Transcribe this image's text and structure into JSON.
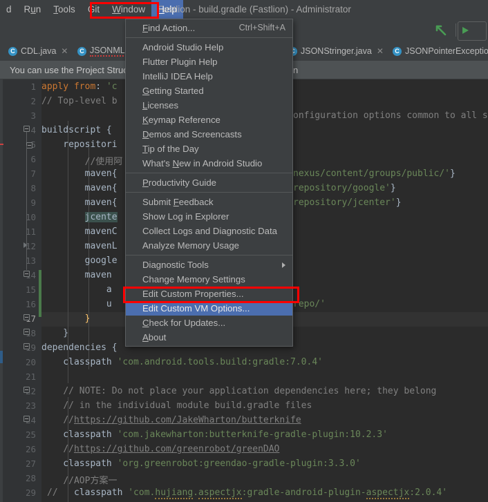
{
  "window": {
    "title": "Fastlion - build.gradle (Fastlion) - Administrator"
  },
  "menubar": {
    "items": [
      {
        "label": "d",
        "accel": ""
      },
      {
        "label": "Run",
        "accel": "u"
      },
      {
        "label": "Tools",
        "accel": "T"
      },
      {
        "label": "Git",
        "accel": ""
      },
      {
        "label": "Window",
        "accel": "W"
      },
      {
        "label": "Help",
        "accel": "H",
        "active": true
      }
    ]
  },
  "toolbar": {
    "back_icon": "back-arrow-icon",
    "run_icon": "run-button-icon"
  },
  "tabs": [
    {
      "label": "CDL.java",
      "icon": "C",
      "closable": true,
      "error": false
    },
    {
      "label": "JSONML.java",
      "icon": "C",
      "closable": true,
      "error": true
    },
    {
      "label": "JSONStringer.java",
      "icon": "C",
      "closable": true,
      "error": false
    },
    {
      "label": "JSONPointerException.java",
      "icon": "C",
      "closable": false,
      "error": false
    }
  ],
  "banner": {
    "text": "You can use the Project Structure dialog to manage project configuration"
  },
  "help_menu": {
    "items": [
      {
        "label": "Find Action...",
        "accel": "F",
        "shortcut": "Ctrl+Shift+A"
      },
      {
        "separator": true
      },
      {
        "label": "Android Studio Help",
        "accel": ""
      },
      {
        "label": "Flutter Plugin Help",
        "accel": ""
      },
      {
        "label": "IntelliJ IDEA Help",
        "accel": ""
      },
      {
        "label": "Getting Started",
        "accel": "G"
      },
      {
        "label": "Licenses",
        "accel": "L"
      },
      {
        "label": "Keymap Reference",
        "accel": "K"
      },
      {
        "label": "Demos and Screencasts",
        "accel": "D"
      },
      {
        "label": "Tip of the Day",
        "accel": "T"
      },
      {
        "label": "What's New in Android Studio",
        "accel": "N"
      },
      {
        "separator": true
      },
      {
        "label": "Productivity Guide",
        "accel": "P"
      },
      {
        "separator": true
      },
      {
        "label": "Submit Feedback",
        "accel": "F"
      },
      {
        "label": "Show Log in Explorer",
        "accel": ""
      },
      {
        "label": "Collect Logs and Diagnostic Data",
        "accel": ""
      },
      {
        "label": "Analyze Memory Usage",
        "accel": ""
      },
      {
        "separator": true
      },
      {
        "label": "Diagnostic Tools",
        "accel": "",
        "submenu": true
      },
      {
        "label": "Change Memory Settings",
        "accel": ""
      },
      {
        "label": "Edit Custom Properties...",
        "accel": ""
      },
      {
        "label": "Edit Custom VM Options...",
        "accel": "",
        "selected": true
      },
      {
        "label": "Check for Updates...",
        "accel": "C"
      },
      {
        "label": "About",
        "accel": "A"
      }
    ]
  },
  "annotations": {
    "help_box_color": "#ff0000",
    "vm_options_box_color": "#ff0000",
    "selection_color": "#4b6eaf"
  },
  "editor": {
    "current_line": 17,
    "lines": [
      {
        "n": 1,
        "html": "<span class=\"kw\">apply</span> <span class=\"kw\">from</span>: <span class=\"str\">'c</span>"
      },
      {
        "n": 2,
        "html": "<span class=\"cmt\">// Top-level b</span>"
      },
      {
        "n": 3,
        "html": ""
      },
      {
        "n": 4,
        "html": "buildscript {"
      },
      {
        "n": 5,
        "html": "    repositori"
      },
      {
        "n": 6,
        "html": "        <span class=\"cmt\">//使用阿</span>"
      },
      {
        "n": 7,
        "html": "        maven{"
      },
      {
        "n": 8,
        "html": "        maven{"
      },
      {
        "n": 9,
        "html": "        maven{"
      },
      {
        "n": 10,
        "html": "        <span class=\"hl\">jcente</span>"
      },
      {
        "n": 11,
        "html": "        mavenC"
      },
      {
        "n": 12,
        "html": "        mavenL"
      },
      {
        "n": 13,
        "html": "        google"
      },
      {
        "n": 14,
        "html": "        maven "
      },
      {
        "n": 15,
        "html": "            a"
      },
      {
        "n": 16,
        "html": "            u"
      },
      {
        "n": 17,
        "html": "        <span class=\"ylw\">}</span>"
      },
      {
        "n": 18,
        "html": "    }"
      },
      {
        "n": 19,
        "html": "dependencies {"
      },
      {
        "n": 20,
        "html": "    classpath <span class=\"str\">'com.android.tools.build:gradle:7.0.4'</span>"
      },
      {
        "n": 21,
        "html": ""
      },
      {
        "n": 22,
        "html": "    <span class=\"cmt\">// NOTE: Do not place your application dependencies here; they belong</span>"
      },
      {
        "n": 23,
        "html": "    <span class=\"cmt\">// in the individual module build.gradle files</span>"
      },
      {
        "n": 24,
        "html": "    <span class=\"cmt\">//</span><span class=\"link\">https://github.com/JakeWharton/butterknife</span>"
      },
      {
        "n": 25,
        "html": "    classpath <span class=\"str\">'com.jakewharton:butterknife-gradle-plugin:10.2.3'</span>"
      },
      {
        "n": 26,
        "html": "    <span class=\"cmt\">//</span><span class=\"link\">https://github.com/greenrobot/greenDAO</span>"
      },
      {
        "n": 27,
        "html": "    classpath <span class=\"str\">'org.greenrobot:greendao-gradle-plugin:3.3.0'</span>"
      },
      {
        "n": 28,
        "html": "    <span class=\"cmt\">//AOP方案一</span>"
      },
      {
        "n": 29,
        "html": "      classpath <span class=\"str\">'com.</span><span class=\"str squig\">hujiang</span><span class=\"str\">.</span><span class=\"str squig\">aspectjx</span><span class=\"str\">:gradle-android-plugin-</span><span class=\"str squig\">aspectjx</span><span class=\"str\">:2.0.4'</span>"
      }
    ],
    "right_fragments": [
      {
        "line": 7,
        "html": "<span class=\"str\">nexus/content/groups/public/'</span><span class=\"brace\">}</span>"
      },
      {
        "line": 8,
        "html": "<span class=\"str\">repository/google'</span><span class=\"brace\">}</span>"
      },
      {
        "line": 9,
        "html": "<span class=\"str\">repository/jcenter'</span><span class=\"brace\">}</span>"
      },
      {
        "line": 16,
        "html": "<span class=\"str\">repo/'</span>"
      }
    ],
    "tail_fragments": [
      {
        "line": 1,
        "html": "onfiguration options common to all su"
      }
    ],
    "comment_prefix_29": "//"
  }
}
